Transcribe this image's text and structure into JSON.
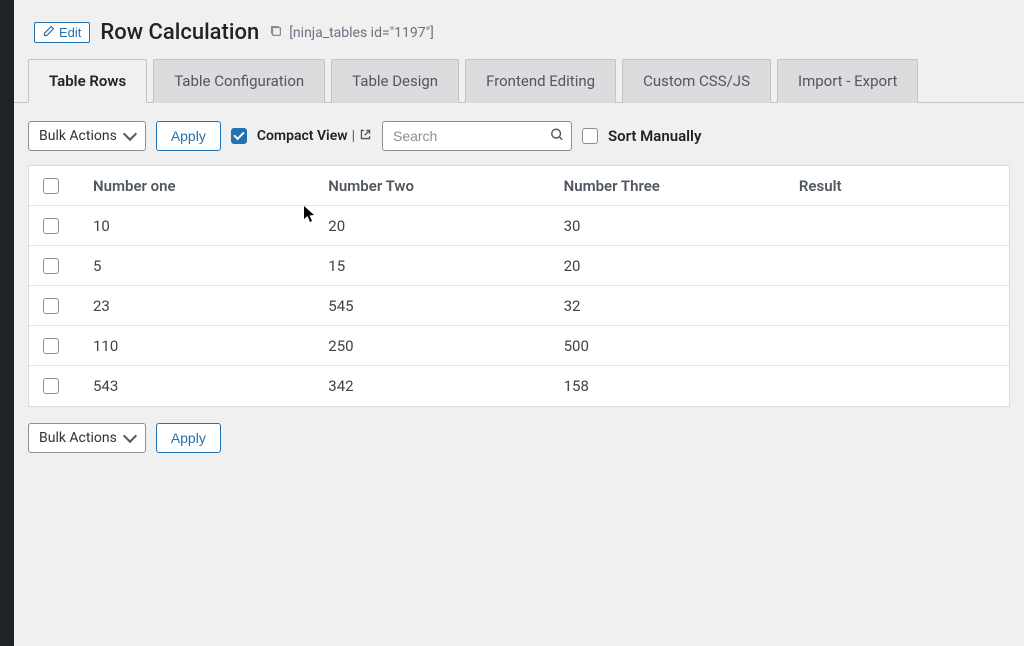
{
  "header": {
    "edit_label": "Edit",
    "title": "Row Calculation",
    "shortcode": "[ninja_tables id=\"1197\"]"
  },
  "tabs": [
    {
      "label": "Table Rows",
      "active": true
    },
    {
      "label": "Table Configuration",
      "active": false
    },
    {
      "label": "Table Design",
      "active": false
    },
    {
      "label": "Frontend Editing",
      "active": false
    },
    {
      "label": "Custom CSS/JS",
      "active": false
    },
    {
      "label": "Import - Export",
      "active": false
    }
  ],
  "toolbar": {
    "bulk_actions_label": "Bulk Actions",
    "apply_label": "Apply",
    "compact_view_label": "Compact View",
    "compact_view_checked": true,
    "search_placeholder": "Search",
    "sort_manually_label": "Sort Manually",
    "sort_manually_checked": false
  },
  "table": {
    "columns": [
      "Number one",
      "Number Two",
      "Number Three",
      "Result"
    ],
    "rows": [
      {
        "c0": "10",
        "c1": "20",
        "c2": "30",
        "c3": ""
      },
      {
        "c0": "5",
        "c1": "15",
        "c2": "20",
        "c3": ""
      },
      {
        "c0": "23",
        "c1": "545",
        "c2": "32",
        "c3": ""
      },
      {
        "c0": "110",
        "c1": "250",
        "c2": "500",
        "c3": ""
      },
      {
        "c0": "543",
        "c1": "342",
        "c2": "158",
        "c3": ""
      }
    ]
  }
}
